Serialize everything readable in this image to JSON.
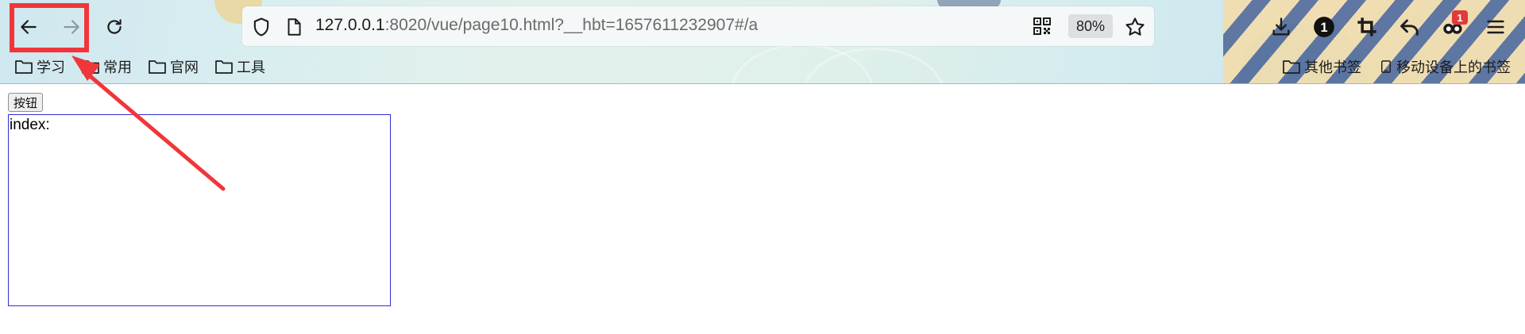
{
  "toolbar": {
    "back": {
      "icon": "back-arrow-icon"
    },
    "forward": {
      "icon": "forward-arrow-icon",
      "disabled": true
    },
    "reload": {
      "icon": "reload-icon"
    }
  },
  "address_bar": {
    "url_host": "127.0.0.1",
    "url_rest": ":8020/vue/page10.html?__hbt=1657611232907#/a",
    "zoom": "80%",
    "icons": [
      "shield-icon",
      "page-icon",
      "qr-code-icon",
      "bookmark-star-icon"
    ]
  },
  "toolbar_right": {
    "icons": [
      "download-icon",
      "account-icon",
      "crop-icon",
      "undo-icon",
      "extensions-icon",
      "menu-icon"
    ],
    "account_badge": "1",
    "extension_badge": "1"
  },
  "bookmarks": {
    "left": [
      {
        "label": "学习",
        "icon": "folder-icon"
      },
      {
        "label": "常用",
        "icon": "folder-icon"
      },
      {
        "label": "官网",
        "icon": "folder-icon"
      },
      {
        "label": "工具",
        "icon": "folder-icon"
      }
    ],
    "right": [
      {
        "label": "其他书签",
        "icon": "folder-icon"
      },
      {
        "label": "移动设备上的书签",
        "icon": "mobile-icon"
      }
    ]
  },
  "page": {
    "button_label": "按钮",
    "index_label": "index:"
  },
  "colors": {
    "annotation": "#f0363a",
    "box_border": "#2f2fd8"
  }
}
